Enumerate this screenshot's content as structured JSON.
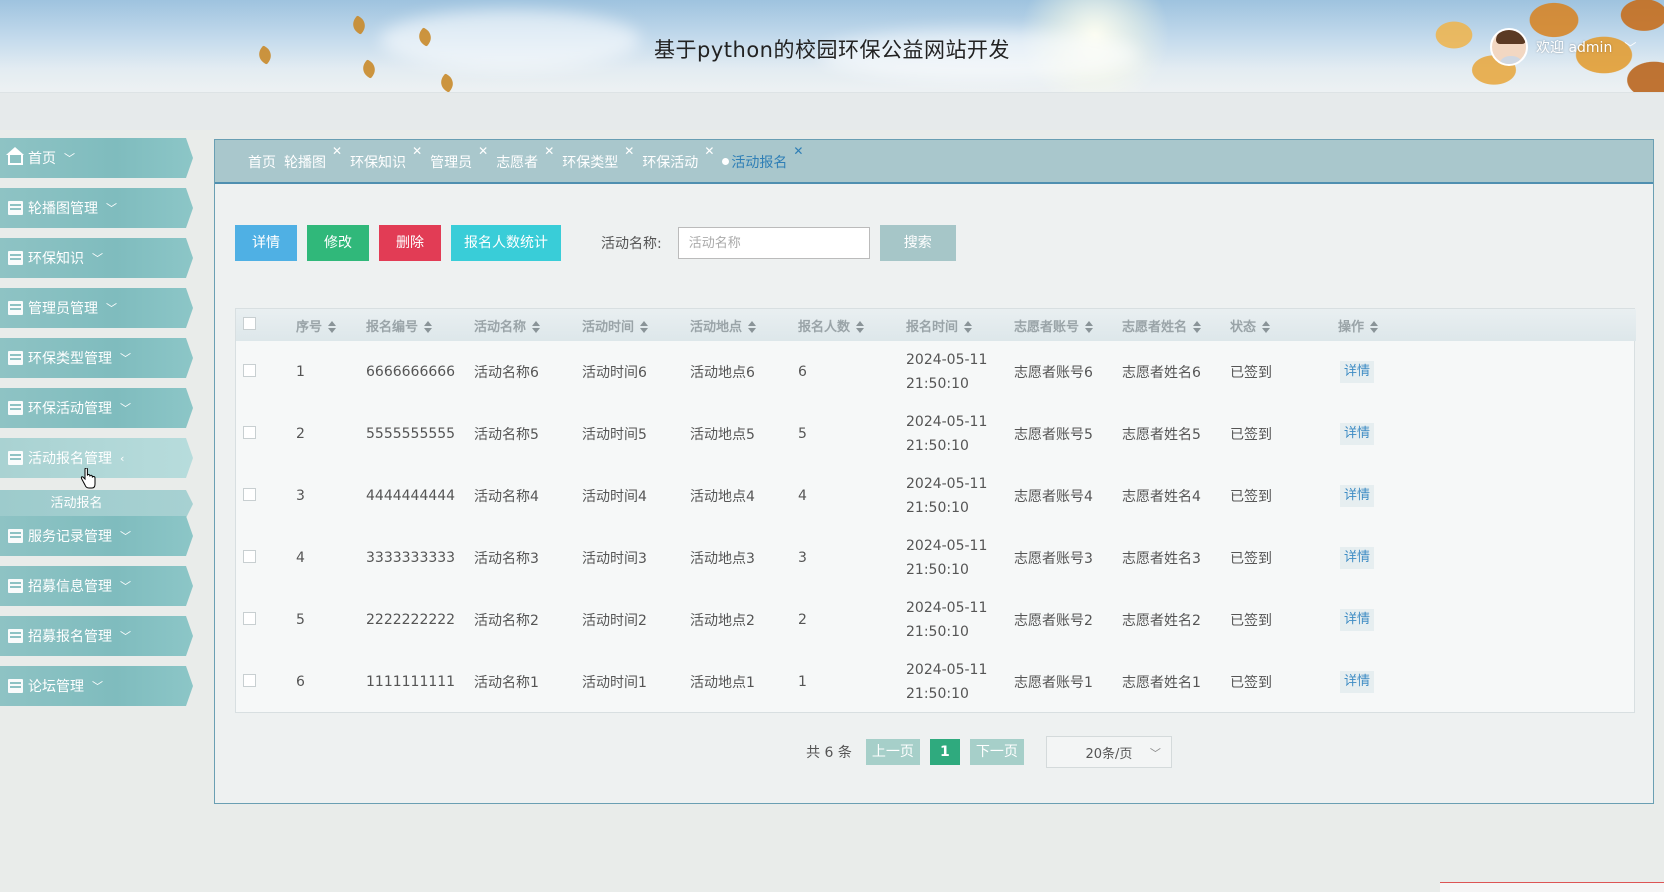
{
  "header": {
    "site_title": "基于python的校园环保公益网站开发",
    "welcome_text": "欢迎 admin"
  },
  "sidebar": {
    "items": [
      {
        "label": "首页",
        "icon": "home-icon"
      },
      {
        "label": "轮播图管理",
        "icon": "image-icon"
      },
      {
        "label": "环保知识",
        "icon": "book-icon"
      },
      {
        "label": "管理员管理",
        "icon": "user-admin-icon"
      },
      {
        "label": "环保类型管理",
        "icon": "category-icon"
      },
      {
        "label": "环保活动管理",
        "icon": "briefcase-icon"
      },
      {
        "label": "活动报名管理",
        "icon": "building-icon",
        "expanded": true
      },
      {
        "label": "服务记录管理",
        "icon": "table-icon"
      },
      {
        "label": "招募信息管理",
        "icon": "list-icon"
      },
      {
        "label": "招募报名管理",
        "icon": "list-icon"
      },
      {
        "label": "论坛管理",
        "icon": "chat-icon"
      }
    ],
    "submenu": {
      "label": "活动报名"
    }
  },
  "tabs": [
    {
      "label": "首页",
      "closable": false
    },
    {
      "label": "轮播图",
      "closable": true
    },
    {
      "label": "环保知识",
      "closable": true
    },
    {
      "label": "管理员",
      "closable": true
    },
    {
      "label": "志愿者",
      "closable": true
    },
    {
      "label": "环保类型",
      "closable": true
    },
    {
      "label": "环保活动",
      "closable": true
    },
    {
      "label": "活动报名",
      "closable": true,
      "active": true
    }
  ],
  "toolbar": {
    "detail_label": "详情",
    "edit_label": "修改",
    "delete_label": "删除",
    "stat_label": "报名人数统计",
    "search_label": "活动名称:",
    "search_placeholder": "活动名称",
    "search_button": "搜索"
  },
  "table": {
    "columns": [
      "序号",
      "报名编号",
      "活动名称",
      "活动时间",
      "活动地点",
      "报名人数",
      "报名时间",
      "志愿者账号",
      "志愿者姓名",
      "状态",
      "操作"
    ],
    "rows": [
      {
        "no": "1",
        "code": "6666666666",
        "name": "活动名称6",
        "time": "活动时间6",
        "place": "活动地点6",
        "count": "6",
        "signup_time": "2024-05-11 21:50:10",
        "account": "志愿者账号6",
        "vname": "志愿者姓名6",
        "status": "已签到",
        "op": "详情"
      },
      {
        "no": "2",
        "code": "5555555555",
        "name": "活动名称5",
        "time": "活动时间5",
        "place": "活动地点5",
        "count": "5",
        "signup_time": "2024-05-11 21:50:10",
        "account": "志愿者账号5",
        "vname": "志愿者姓名5",
        "status": "已签到",
        "op": "详情"
      },
      {
        "no": "3",
        "code": "4444444444",
        "name": "活动名称4",
        "time": "活动时间4",
        "place": "活动地点4",
        "count": "4",
        "signup_time": "2024-05-11 21:50:10",
        "account": "志愿者账号4",
        "vname": "志愿者姓名4",
        "status": "已签到",
        "op": "详情"
      },
      {
        "no": "4",
        "code": "3333333333",
        "name": "活动名称3",
        "time": "活动时间3",
        "place": "活动地点3",
        "count": "3",
        "signup_time": "2024-05-11 21:50:10",
        "account": "志愿者账号3",
        "vname": "志愿者姓名3",
        "status": "已签到",
        "op": "详情"
      },
      {
        "no": "5",
        "code": "2222222222",
        "name": "活动名称2",
        "time": "活动时间2",
        "place": "活动地点2",
        "count": "2",
        "signup_time": "2024-05-11 21:50:10",
        "account": "志愿者账号2",
        "vname": "志愿者姓名2",
        "status": "已签到",
        "op": "详情"
      },
      {
        "no": "6",
        "code": "1111111111",
        "name": "活动名称1",
        "time": "活动时间1",
        "place": "活动地点1",
        "count": "1",
        "signup_time": "2024-05-11 21:50:10",
        "account": "志愿者账号1",
        "vname": "志愿者姓名1",
        "status": "已签到",
        "op": "详情"
      }
    ]
  },
  "pagination": {
    "total_text": "共 6 条",
    "prev_label": "上一页",
    "current_page": "1",
    "next_label": "下一页",
    "page_size": "20条/页"
  },
  "colors": {
    "sidebar": "#8ec3c4",
    "tabbar": "#a9c7cc",
    "active_tab": "#2f7fb6",
    "btn_detail": "#4fb0e4",
    "btn_edit": "#30b87a",
    "btn_delete": "#e23c55",
    "btn_stat": "#39cdd8",
    "current_page": "#2faa7e"
  }
}
